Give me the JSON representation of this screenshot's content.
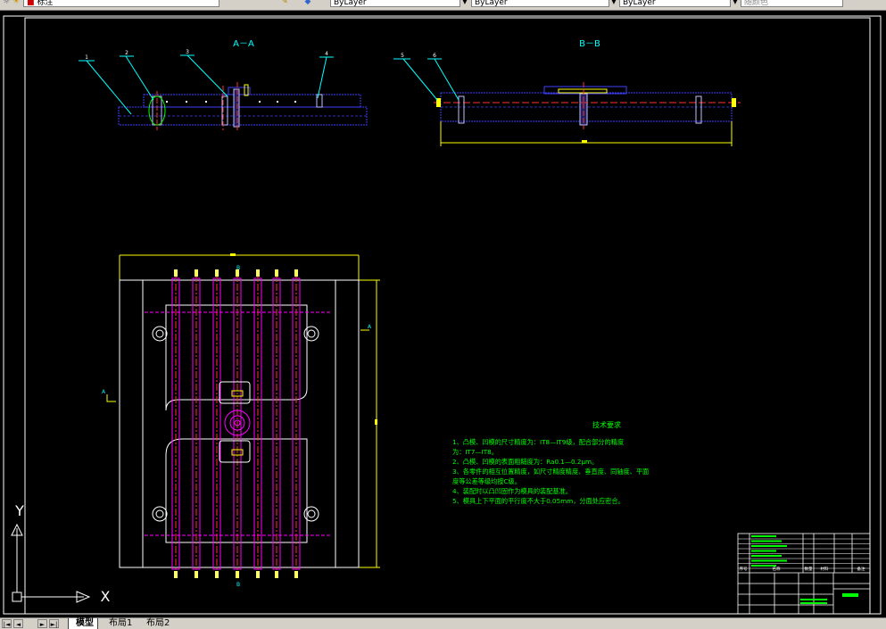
{
  "toolbar": {
    "layer_name": "标注",
    "dropdown_1": "ByLayer",
    "dropdown_2": "ByLayer",
    "dropdown_3": "ByLayer",
    "plot_style": "随颜色"
  },
  "drawing": {
    "section_aa": "A－A",
    "section_bb": "B－B",
    "balloons": [
      "1",
      "2",
      "3",
      "4",
      "5",
      "6"
    ],
    "view_markers": [
      "A",
      "A",
      "B",
      "B"
    ],
    "tech_title": "技术要求",
    "tech_lines": [
      "1、凸模、凹模的尺寸精度为：IT8—IT9级，配合部分的精度",
      "为：IT7—IT8。",
      "2、凸模、凹模的表面粗糙度为：Ra0.1—0.2μm。",
      "3、各零件的相互位置精度，如尺寸精度精度、垂直度、同轴度、平面",
      "度等公差等级均按C级。",
      "4、装配时以凸凹固作为模具的装配基准。",
      "5、模具上下平面的平行度不大于0.05mm，分面处应密合。"
    ],
    "title_block_labels": [
      "序号",
      "名称",
      "数量",
      "材料",
      "备注"
    ],
    "ucs_x": "X",
    "ucs_y": "Y"
  },
  "colors": {
    "frame": "#ffffff",
    "part": "#4040ff",
    "center": "#ff3030",
    "hidden": "#ff00ff",
    "dimension": "#ffff00",
    "leader": "#00ffff",
    "text": "#00ff00"
  },
  "layout_tabs": {
    "model": "模型",
    "layout1": "布局1",
    "layout2": "布局2",
    "nav_first": "|◄",
    "nav_prev": "◄",
    "nav_next": "►",
    "nav_last": "►|"
  }
}
